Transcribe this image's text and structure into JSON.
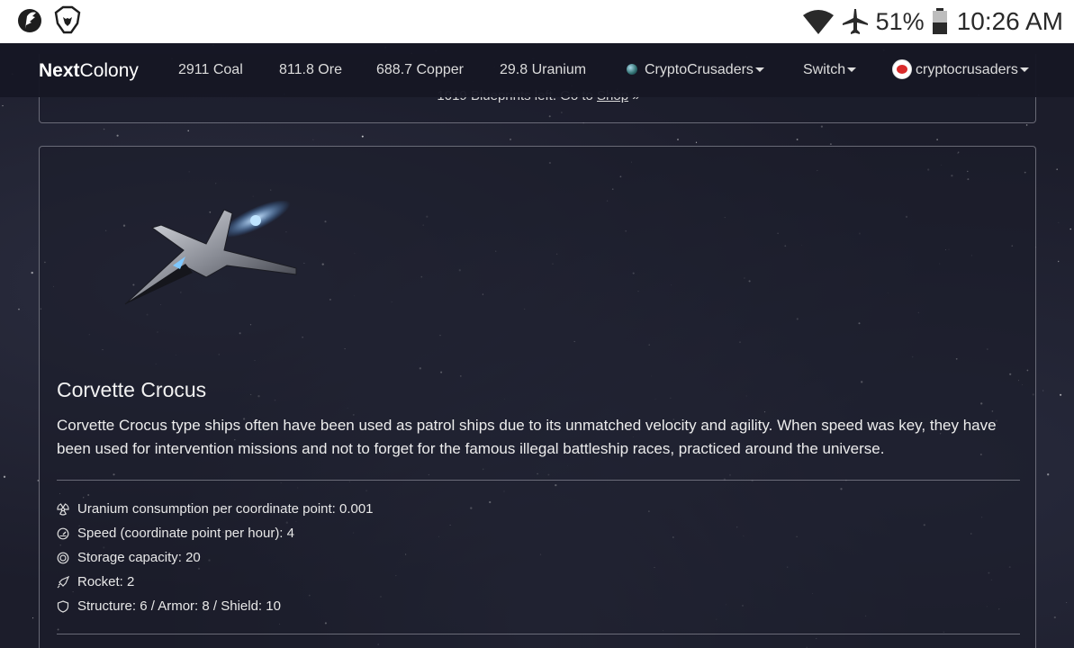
{
  "status_bar": {
    "left_icons": [
      "feather-app-icon",
      "brave-lion-icon"
    ],
    "right_icons": [
      "wifi-icon",
      "airplane-icon",
      "battery-icon"
    ],
    "battery_text": "51%",
    "time": "10:26 AM"
  },
  "navbar": {
    "brand_bold": "Next",
    "brand_rest": "Colony",
    "resources": {
      "coal": "2911 Coal",
      "ore": "811.8 Ore",
      "copper": "688.7 Copper",
      "uranium": "29.8 Uranium"
    },
    "planet": "CryptoCrusaders",
    "switch": "Switch",
    "user": "cryptocrusaders"
  },
  "prev_card": {
    "text": "1019 Blueprints left. Go to",
    "link": "Shop",
    "trailer": "»"
  },
  "ship": {
    "name": "Corvette Crocus",
    "description": "Corvette Crocus type ships often have been used as patrol ships due to its unmatched velocity and agility. When speed was key, they have been used for intervention missions and not to forget for the famous illegal battleship races, practiced around the universe.",
    "stats": [
      {
        "icon": "radiation-icon",
        "text": "Uranium consumption per coordinate point: 0.001"
      },
      {
        "icon": "speedometer-icon",
        "text": "Speed (coordinate point per hour): 4"
      },
      {
        "icon": "storage-icon",
        "text": "Storage capacity: 20"
      },
      {
        "icon": "rocket-icon",
        "text": "Rocket: 2"
      },
      {
        "icon": "shield-icon",
        "text": "Structure: 6 / Armor: 8 / Shield: 10"
      }
    ]
  },
  "colors": {
    "background": "#1c1d2b",
    "navbar": "#161724",
    "card_border": "#c8c8d2",
    "status_bar": "#ffffff"
  }
}
